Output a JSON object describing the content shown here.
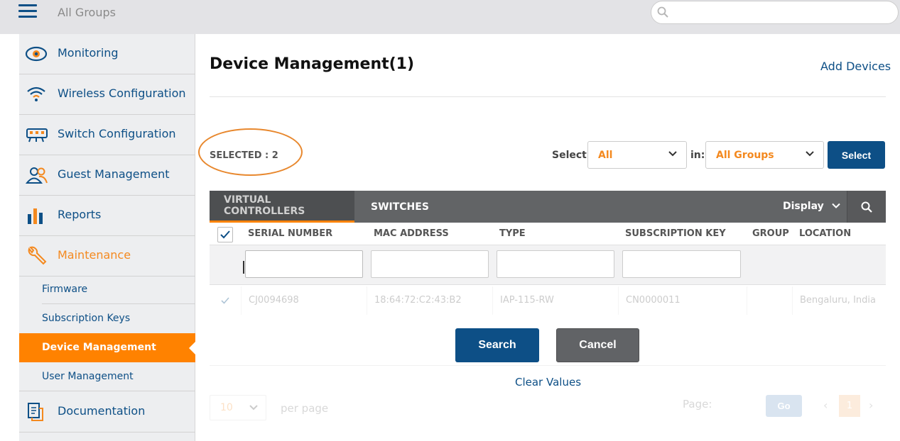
{
  "header": {
    "group_title": "All Groups",
    "search_placeholder": ""
  },
  "sidebar": {
    "items": [
      {
        "label": "Monitoring",
        "icon": "eye-icon"
      },
      {
        "label": "Wireless Configuration",
        "icon": "wifi-icon"
      },
      {
        "label": "Switch Configuration",
        "icon": "switch-icon"
      },
      {
        "label": "Guest Management",
        "icon": "users-icon"
      },
      {
        "label": "Reports",
        "icon": "bar-chart-icon"
      },
      {
        "label": "Maintenance",
        "icon": "wrench-icon"
      }
    ],
    "maintenance_sub": [
      {
        "label": "Firmware"
      },
      {
        "label": "Subscription Keys"
      },
      {
        "label": "Device Management"
      },
      {
        "label": "User Management"
      }
    ],
    "documentation": {
      "label": "Documentation",
      "icon": "document-icon"
    }
  },
  "main": {
    "title": "Device Management(1)",
    "add_devices": "Add Devices",
    "selected_count": "SELECTED : 2",
    "select_label": "Select:",
    "select_value": "All",
    "in_label": "in:",
    "group_value": "All Groups",
    "select_button": "Select",
    "tabs": [
      {
        "label": "VIRTUAL CONTROLLERS"
      },
      {
        "label": "SWITCHES"
      }
    ],
    "display_label": "Display",
    "columns": [
      "SERIAL NUMBER",
      "MAC ADDRESS",
      "TYPE",
      "SUBSCRIPTION KEY",
      "GROUP",
      "LOCATION"
    ],
    "row": {
      "serial": "CJ0094698",
      "mac": "18:64:72:C2:43:B2",
      "type": "IAP-115-RW",
      "key": "CN0000011",
      "group": "",
      "location": "Bengaluru, India"
    },
    "search_button": "Search",
    "cancel_button": "Cancel",
    "clear_values": "Clear Values",
    "footer": {
      "per_page_value": "10",
      "per_page_label": "per page",
      "page_label": "Page:",
      "go": "Go",
      "current_page": "1"
    }
  },
  "colors": {
    "accent": "#ff8200",
    "brand": "#0d4f86"
  }
}
